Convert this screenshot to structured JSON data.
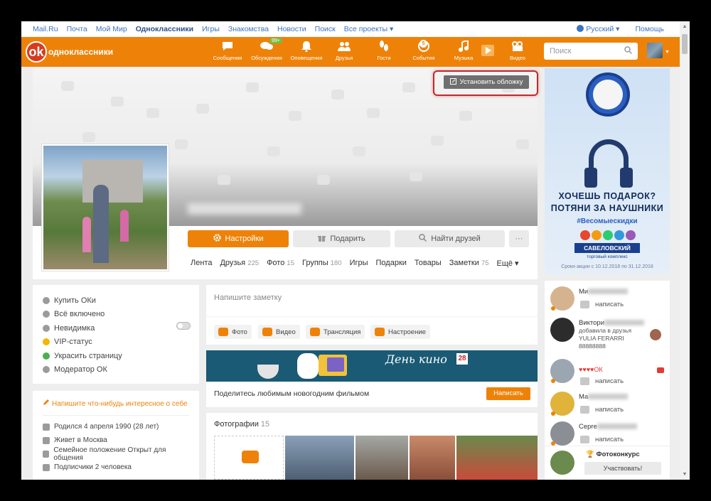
{
  "portal": {
    "links": [
      "Mail.Ru",
      "Почта",
      "Мой Мир",
      "Одноклассники",
      "Игры",
      "Знакомства",
      "Новости",
      "Поиск",
      "Все проекты ▾"
    ],
    "language": "Русский ▾",
    "help": "Помощь"
  },
  "header": {
    "logo_text": "одноклассники",
    "nav": [
      {
        "label": "Сообщения",
        "icon": "messages-icon"
      },
      {
        "label": "Обсуждения",
        "icon": "discussions-icon",
        "badge": "99+"
      },
      {
        "label": "Оповещения",
        "icon": "bell-icon"
      },
      {
        "label": "Друзья",
        "icon": "friends-icon"
      },
      {
        "label": "Гости",
        "icon": "footprints-icon"
      },
      {
        "label": "События",
        "icon": "events-icon",
        "badge": "5"
      },
      {
        "label": "Музыка",
        "icon": "music-icon"
      },
      {
        "label": "Видео",
        "icon": "video-icon"
      }
    ],
    "search_placeholder": "Поиск"
  },
  "profile": {
    "cover_button": "Установить обложку",
    "buttons": {
      "settings": "Настройки",
      "gift": "Подарить",
      "find_friends": "Найти друзей",
      "more": "···"
    },
    "tabs": [
      {
        "label": "Лента",
        "count": ""
      },
      {
        "label": "Друзья",
        "count": "225"
      },
      {
        "label": "Фото",
        "count": "15"
      },
      {
        "label": "Группы",
        "count": "180"
      },
      {
        "label": "Игры",
        "count": ""
      },
      {
        "label": "Подарки",
        "count": ""
      },
      {
        "label": "Товары",
        "count": ""
      },
      {
        "label": "Заметки",
        "count": "75"
      },
      {
        "label": "Ещё ▾",
        "count": ""
      }
    ]
  },
  "ad": {
    "headline": "ХОЧЕШЬ ПОДАРОК? ПОТЯНИ ЗА НАУШНИКИ",
    "hashtag": "#Весомыескидки",
    "mall": "САВЕЛОВСКИЙ",
    "mall_sub": "торговый комплекс",
    "promo": "Сроки акции с 10.12.2018 по 31.12.2018"
  },
  "left_menu": {
    "items": [
      "Купить ОКи",
      "Всё включено",
      "Невидимка",
      "VIP-статус",
      "Украсить страницу",
      "Модератор ОК"
    ]
  },
  "about": {
    "write_prompt": "Напишите что-нибудь интересное о себе",
    "items": [
      "Родился 4 апреля 1990 (28 лет)",
      "Живет в Москва",
      "Семейное положение Открыт для общения",
      "Подписчики 2 человека"
    ]
  },
  "note": {
    "placeholder": "Напишите заметку",
    "media": [
      "Фото",
      "Видео",
      "Трансляция",
      "Настроение"
    ]
  },
  "banner": {
    "title": "День кино",
    "calendar_day": "28",
    "share_text": "Поделитесь любимым новогодним фильмом",
    "button": "Написать"
  },
  "photos": {
    "title": "Фотографии",
    "count": "15"
  },
  "friends": {
    "write_label": "написать",
    "list": [
      {
        "name": "Ми"
      },
      {
        "name": "Виктори",
        "added": "добавила в друзья",
        "friend": "YULIA FERARRI",
        "number": "88888888"
      },
      {
        "name": "",
        "hearts": "♥♥♥♥ОК"
      },
      {
        "name": "Ма"
      },
      {
        "name": "Серге"
      }
    ],
    "contest_title": "Фотоконкурс",
    "contest_button": "Участвовать!"
  },
  "colors": {
    "accent": "#ee8208",
    "link": "#3b72c4",
    "highlight": "#c62828"
  }
}
